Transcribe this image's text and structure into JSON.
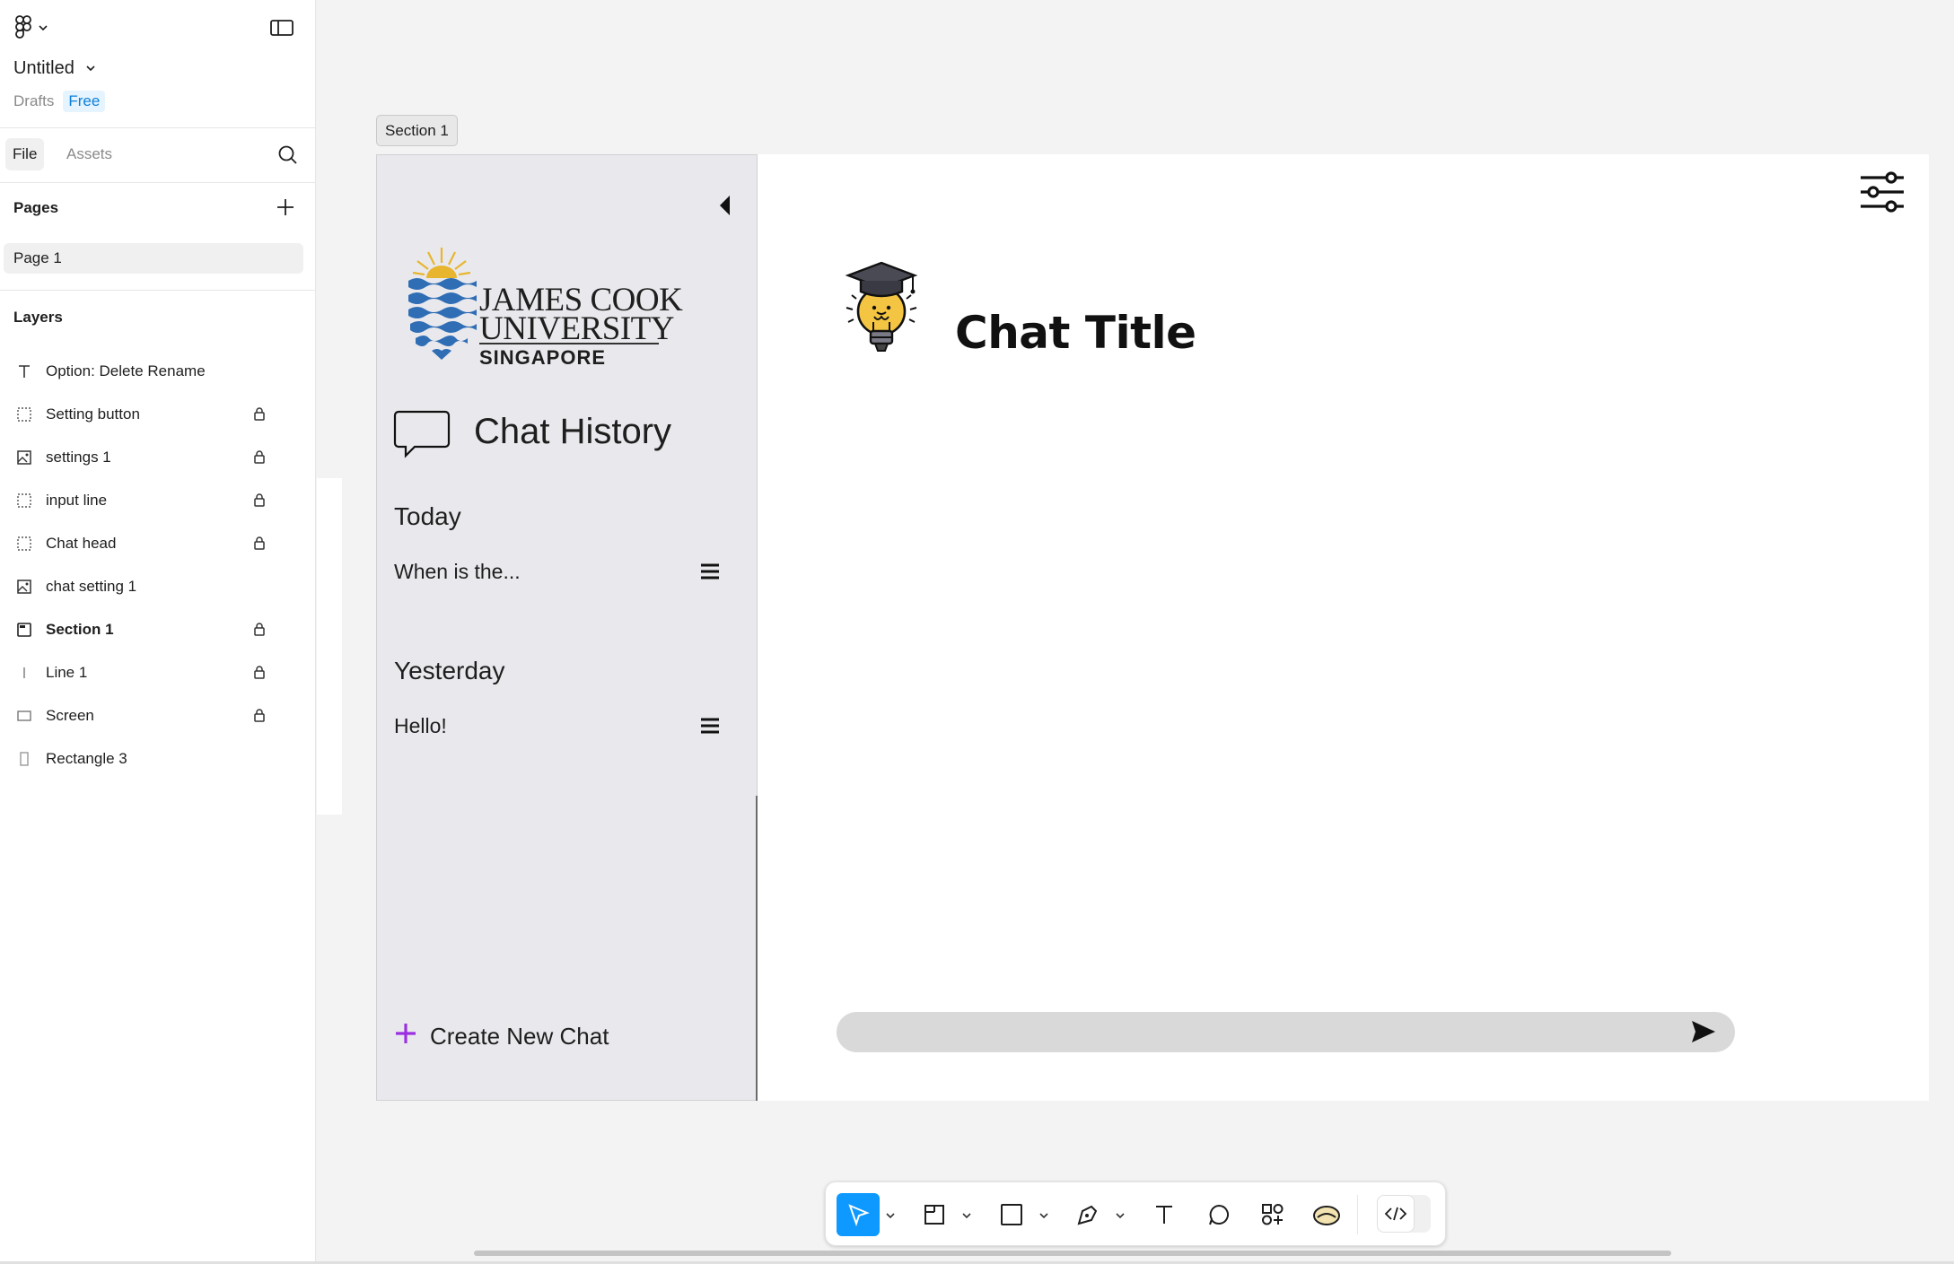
{
  "file": {
    "title": "Untitled",
    "location": "Drafts",
    "plan": "Free"
  },
  "panel_tabs": {
    "file": "File",
    "assets": "Assets"
  },
  "pages": {
    "header": "Pages",
    "items": [
      "Page 1"
    ]
  },
  "layers": {
    "header": "Layers",
    "items": [
      {
        "name": "Option: Delete Rename",
        "type": "text",
        "locked": false
      },
      {
        "name": "Setting button",
        "type": "frame",
        "locked": true
      },
      {
        "name": "settings 1",
        "type": "image",
        "locked": true
      },
      {
        "name": "input line",
        "type": "frame",
        "locked": true
      },
      {
        "name": "Chat head",
        "type": "frame",
        "locked": true
      },
      {
        "name": "chat setting 1",
        "type": "image",
        "locked": false
      },
      {
        "name": "Section 1",
        "type": "section",
        "locked": true,
        "bold": true
      },
      {
        "name": "Line 1",
        "type": "line",
        "locked": true
      },
      {
        "name": "Screen",
        "type": "rectangle",
        "locked": true
      },
      {
        "name": "Rectangle 3",
        "type": "rectangle-tall",
        "locked": false
      }
    ]
  },
  "canvas": {
    "section_label": "Section 1"
  },
  "design": {
    "logo": {
      "line1": "JAMES COOK",
      "line2": "UNIVERSITY",
      "line3": "SINGAPORE"
    },
    "history_title": "Chat History",
    "groups": [
      {
        "label": "Today",
        "chats": [
          "When is the..."
        ]
      },
      {
        "label": "Yesterday",
        "chats": [
          "Hello!"
        ]
      }
    ],
    "new_chat": "Create New Chat",
    "chat_title": "Chat Title",
    "input_placeholder": "",
    "accent_color": "#9b30e0",
    "logo_blue": "#2f6db5",
    "logo_gold": "#e8b52e"
  },
  "toolbar": {
    "tools": [
      "move-tool",
      "frame-tool",
      "shape-tool",
      "pen-tool",
      "text-tool",
      "comment-tool",
      "actions-tool",
      "ai-tool",
      "dev-mode-toggle"
    ],
    "active_color": "#0d99ff"
  }
}
